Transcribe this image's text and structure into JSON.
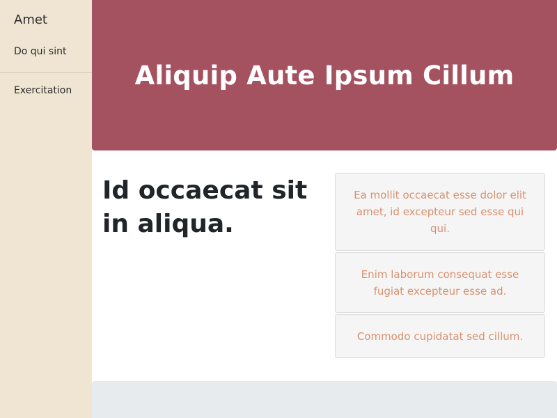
{
  "sidebar": {
    "brand": "Amet",
    "items": [
      {
        "label": "Do qui sint"
      },
      {
        "label": "Exercitation"
      }
    ]
  },
  "hero": {
    "title": "Aliquip Aute Ipsum Cillum",
    "background": "#a45260"
  },
  "main": {
    "heading": "Id occaecat sit in aliqua.",
    "cards": [
      {
        "text": "Ea mollit occaecat esse dolor elit amet, id excepteur sed esse qui qui."
      },
      {
        "text": "Enim laborum consequat esse fugiat excepteur esse ad."
      },
      {
        "text": "Commodo cupidatat sed cillum."
      }
    ]
  },
  "colors": {
    "sidebar_bg": "#efe5d2",
    "card_text": "#d9906e",
    "footer_bg": "#e8ebee"
  }
}
